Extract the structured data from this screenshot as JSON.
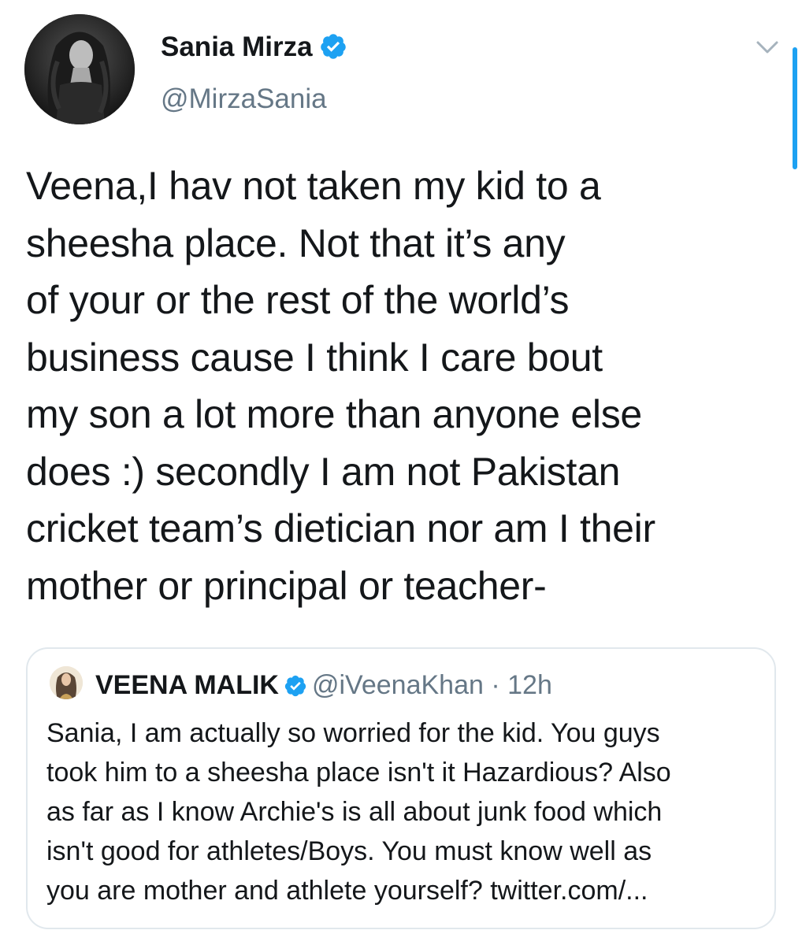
{
  "tweet": {
    "author": {
      "name": "Sania Mirza",
      "handle": "@MirzaSania",
      "avatar_icon": "profile-photo",
      "verified_icon": "verified-badge-icon"
    },
    "menu_icon": "chevron-down-icon",
    "text": "Veena,I hav not taken my kid to a\nsheesha place. Not that it’s any\nof your or the rest of the world’s\nbusiness cause I think I care bout\nmy son a lot more than anyone else\ndoes :) secondly I am not Pakistan\ncricket team’s dietician nor am I their\nmother or principal or teacher-"
  },
  "quoted_tweet": {
    "author": {
      "name": "VEENA MALIK",
      "handle": "@iVeenaKhan",
      "avatar_icon": "profile-photo",
      "verified_icon": "verified-badge-icon"
    },
    "separator": "·",
    "time": "12h",
    "text": "Sania, I am actually so worried for the kid. You guys\ntook him to a sheesha place isn't it Hazardious? Also\nas far as I know Archie's is all about junk food which\nisn't good for athletes/Boys. You must know well as\nyou are mother and athlete yourself? twitter.com/..."
  },
  "colors": {
    "verified": "#1da1f2",
    "text": "#14171a",
    "secondary": "#657786",
    "border": "#e1e8ed",
    "scroll_indicator": "#1da1f2"
  }
}
